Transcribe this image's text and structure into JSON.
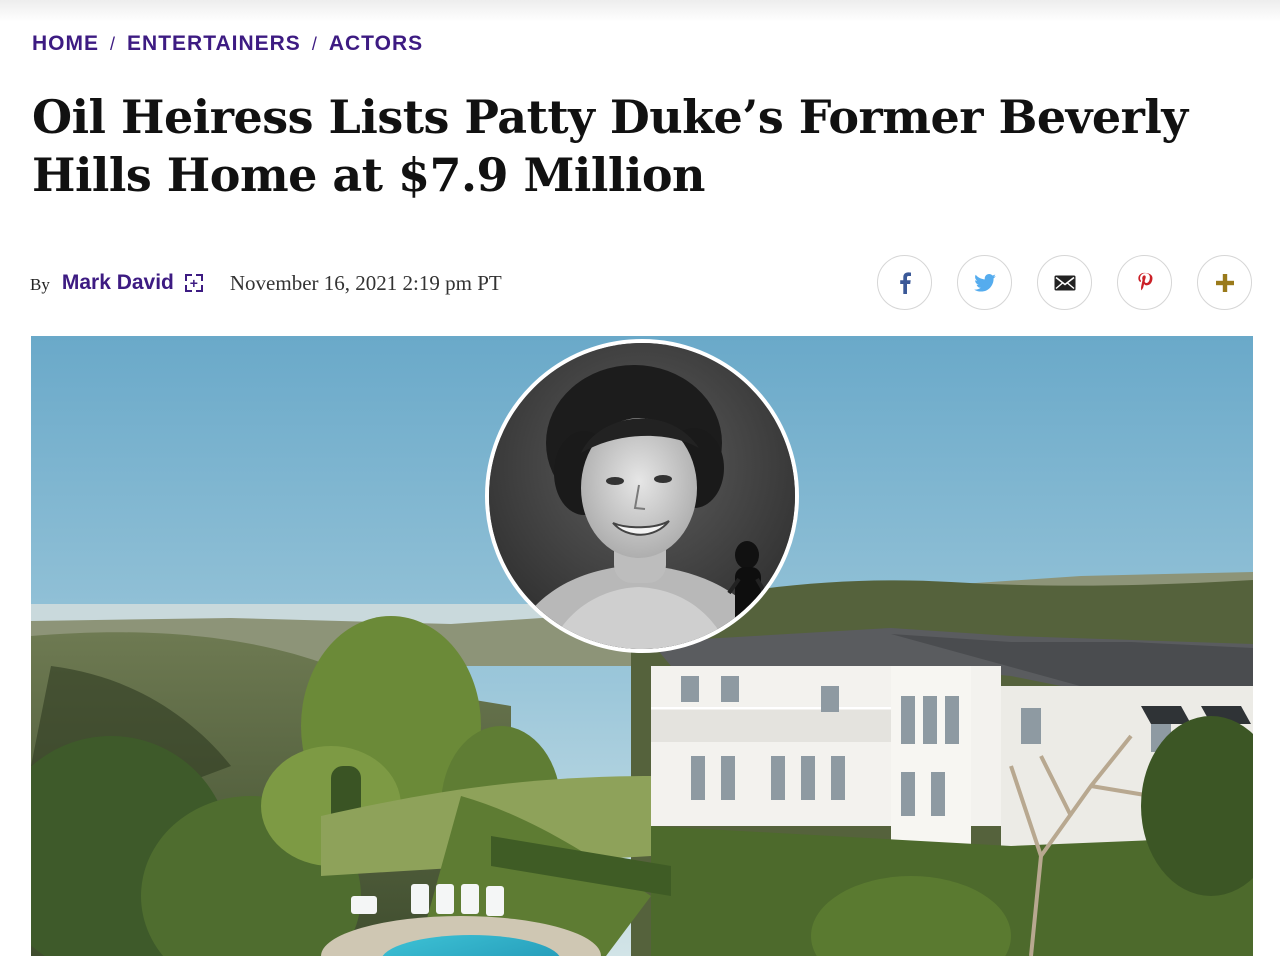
{
  "breadcrumb": {
    "items": [
      {
        "label": "HOME"
      },
      {
        "label": "ENTERTAINERS"
      },
      {
        "label": "ACTORS"
      }
    ],
    "separator": "/"
  },
  "article": {
    "headline": "Oil Heiress Lists Patty Duke’s Former Beverly Hills Home at $7.9 Million",
    "byline_prefix": "By",
    "author": "Mark David",
    "date": "November 16, 2021 2:19 pm PT"
  },
  "share": {
    "buttons": [
      {
        "icon": "facebook-icon",
        "color": "#3b5998"
      },
      {
        "icon": "twitter-icon",
        "color": "#55acee"
      },
      {
        "icon": "email-icon",
        "color": "#222222"
      },
      {
        "icon": "pinterest-icon",
        "color": "#cb2027"
      },
      {
        "icon": "plus-icon",
        "color": "#9a7a1a"
      }
    ]
  },
  "colors": {
    "brand_purple": "#3d1b82",
    "headline": "#111111"
  }
}
